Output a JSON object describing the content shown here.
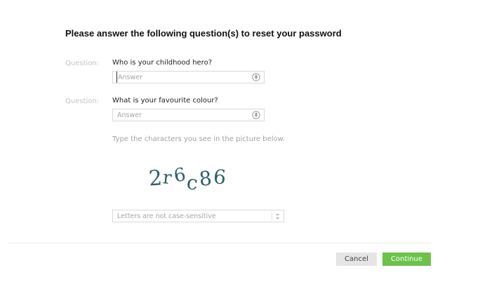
{
  "title": "Please answer the following question(s) to reset your password",
  "questions": [
    {
      "label": "Question:",
      "text": "Who is your childhood hero?",
      "placeholder": "Answer"
    },
    {
      "label": "Question:",
      "text": "What is your favourite colour?",
      "placeholder": "Answer"
    }
  ],
  "captcha": {
    "hint": "Type the characters you see in the picture below.",
    "image_text": "2r6c86",
    "placeholder": "Letters are not case-sensitive"
  },
  "buttons": {
    "cancel": "Cancel",
    "continue": "Continue"
  },
  "colors": {
    "continue": "#6cc24a",
    "captcha_ink": "#2f5f66"
  },
  "icons": {
    "answer_field": "microphone-icon",
    "captcha_field": "refresh-icon"
  }
}
